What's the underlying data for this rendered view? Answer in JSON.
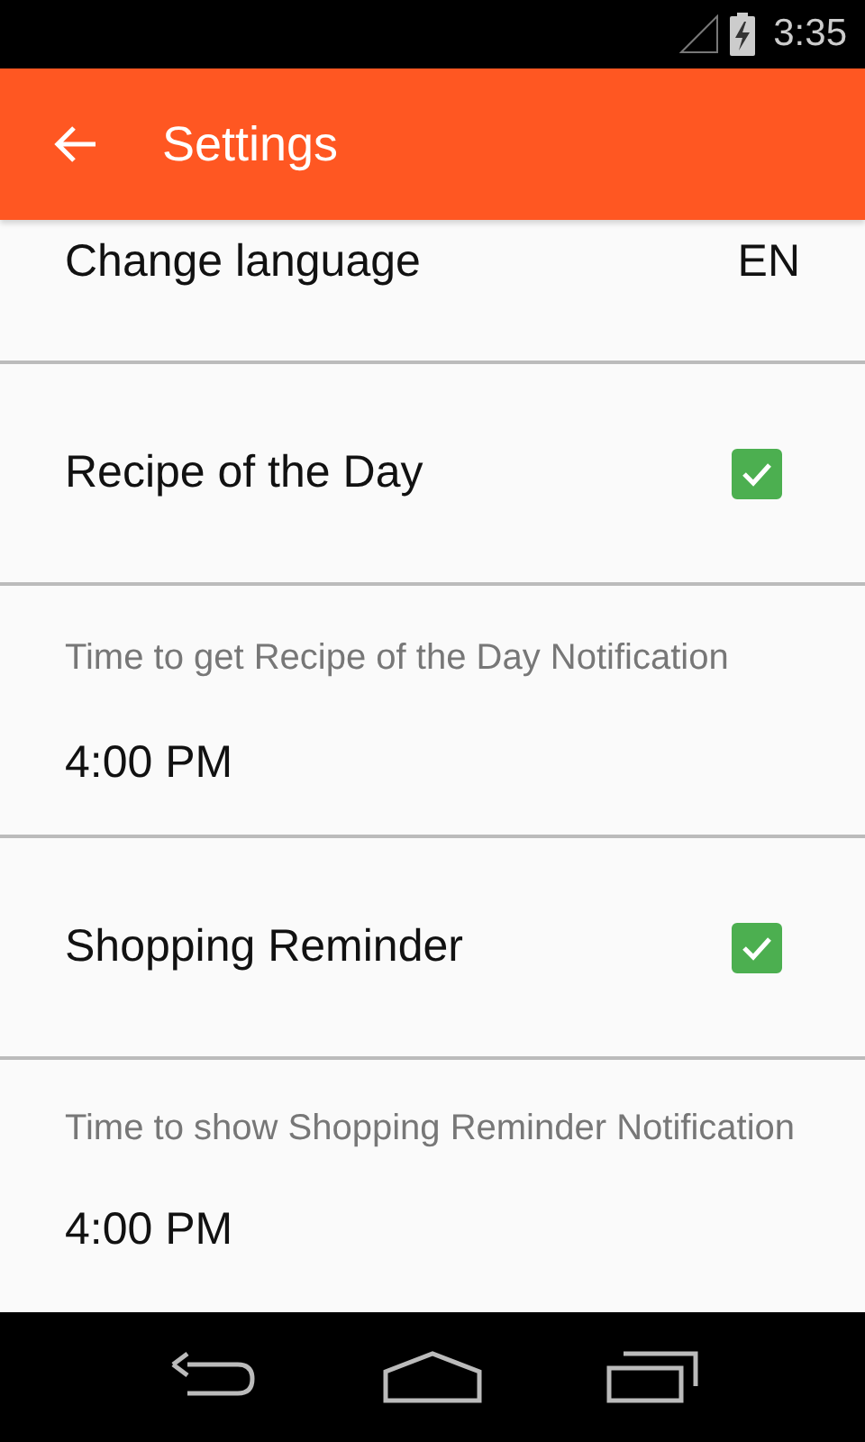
{
  "status_bar": {
    "time": "3:35"
  },
  "app_bar": {
    "title": "Settings"
  },
  "settings": [
    {
      "kind": "value",
      "label": "Change language",
      "value": "EN"
    },
    {
      "kind": "checkbox",
      "label": "Recipe of the Day",
      "checked": true
    },
    {
      "kind": "time",
      "label": "Time to get Recipe of the Day Notification",
      "value": "4:00 PM"
    },
    {
      "kind": "checkbox",
      "label": "Shopping Reminder",
      "checked": true
    },
    {
      "kind": "time",
      "label": "Time to show Shopping Reminder Notification",
      "value": "4:00 PM"
    }
  ]
}
